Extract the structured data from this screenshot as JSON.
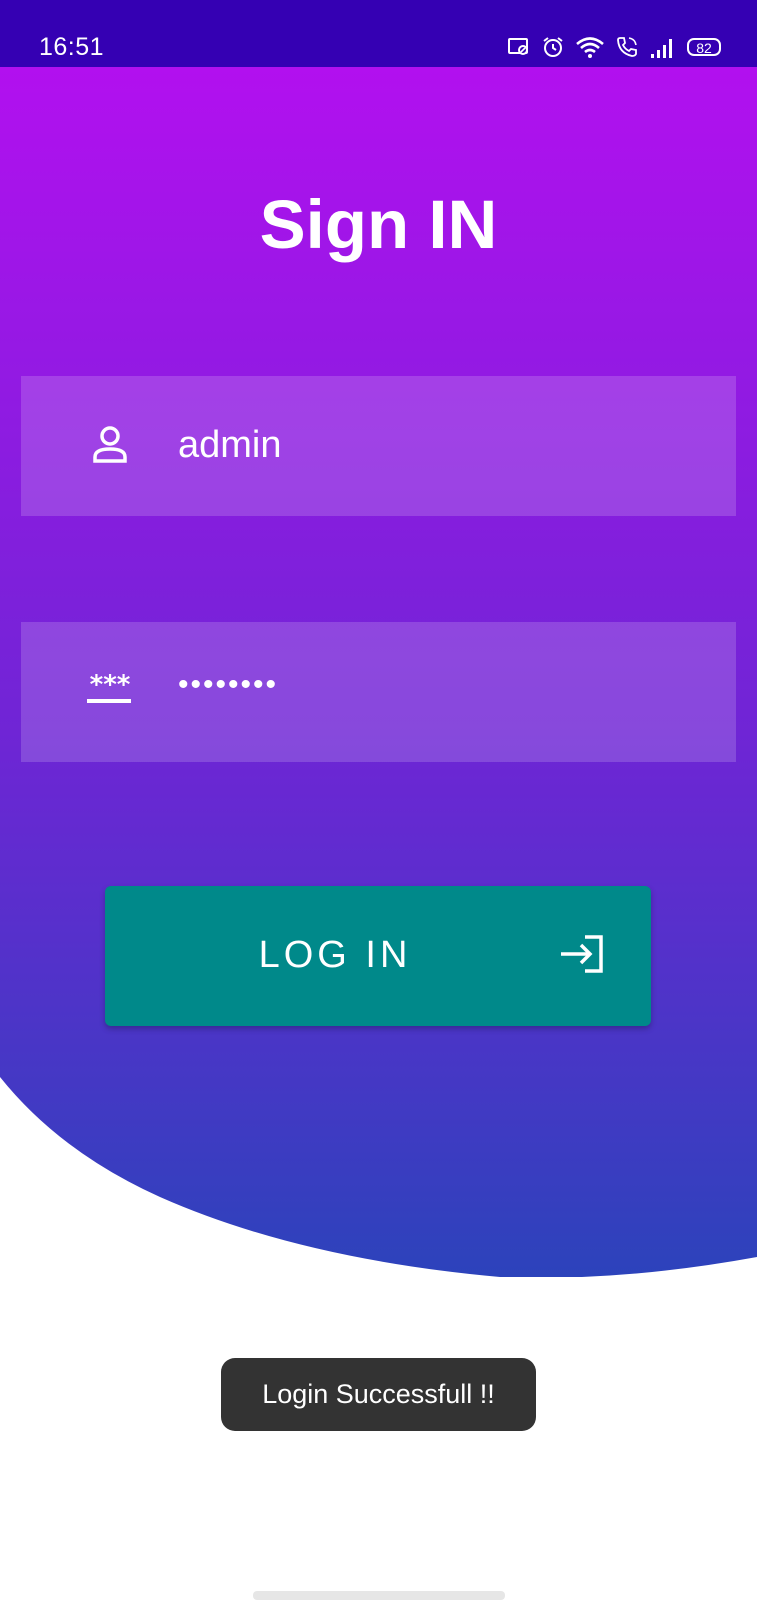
{
  "status_bar": {
    "time": "16:51",
    "battery": "82",
    "icons": [
      "cast-icon",
      "alarm-icon",
      "wifi-icon",
      "call-icon",
      "signal-icon",
      "battery-icon"
    ]
  },
  "screen": {
    "title": "Sign IN",
    "username_field": {
      "value": "admin",
      "icon": "person-icon"
    },
    "password_field": {
      "value": "••••••••",
      "icon": "password-icon"
    },
    "login_button": {
      "label": "LOG IN",
      "icon": "login-arrow-icon"
    },
    "toast": "Login Successfull !!"
  },
  "colors": {
    "status_bar": "#3500b3",
    "gradient_top": "#b210ef",
    "gradient_bottom": "#2c43bb",
    "button": "#00898a",
    "toast": "#333333"
  }
}
